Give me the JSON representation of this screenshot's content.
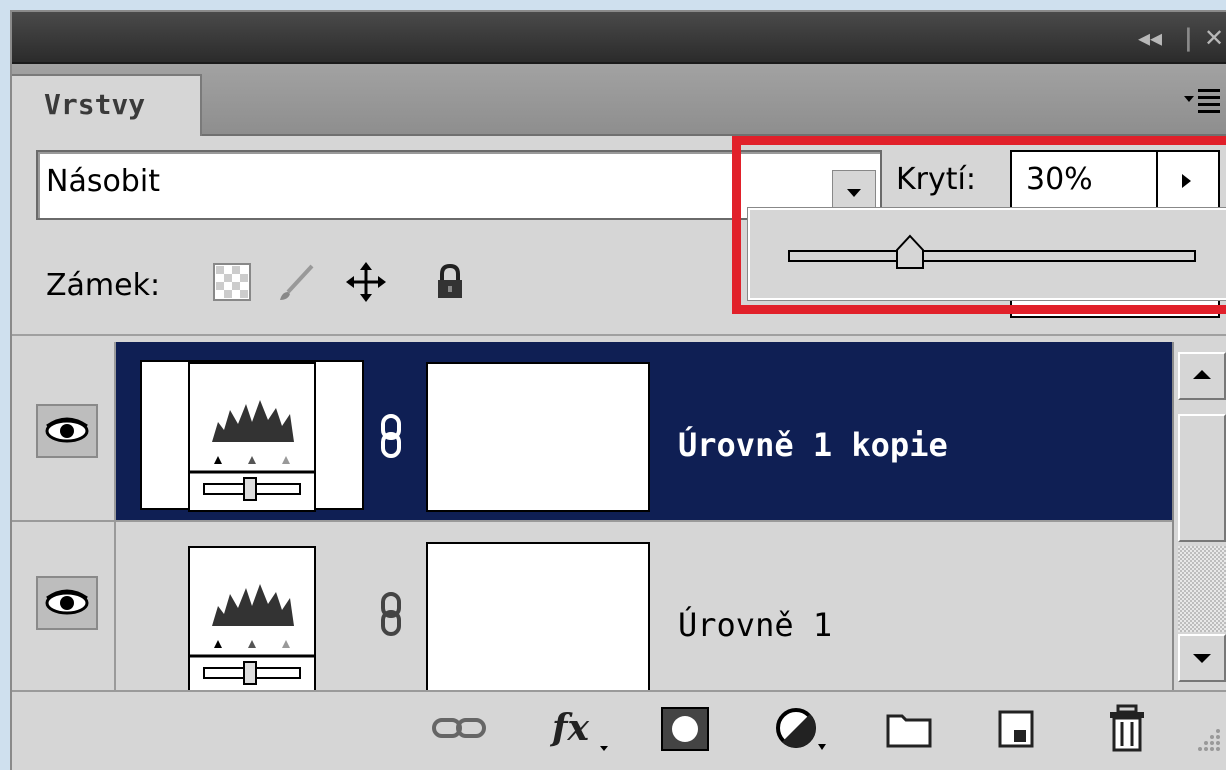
{
  "panel": {
    "title_controls": {
      "collapse": "◂◂",
      "close": "✕"
    },
    "tab_label": "Vrstvy",
    "menu_icon": "panel-menu-icon"
  },
  "blend": {
    "mode": "Násobit"
  },
  "opacity": {
    "label": "Krytí:",
    "value": "30%",
    "slider_percent": 30
  },
  "lock": {
    "label": "Zámek:"
  },
  "layers": [
    {
      "name": "Úrovně 1 kopie",
      "selected": true,
      "visible": true
    },
    {
      "name": "Úrovně 1",
      "selected": false,
      "visible": true
    }
  ],
  "footer_icons": [
    "link-layers-icon",
    "fx-icon",
    "add-mask-icon",
    "adjustment-layer-icon",
    "new-group-icon",
    "new-layer-icon",
    "delete-layer-icon"
  ],
  "colors": {
    "selection": "#0f1f54",
    "highlight": "#e1202a"
  }
}
